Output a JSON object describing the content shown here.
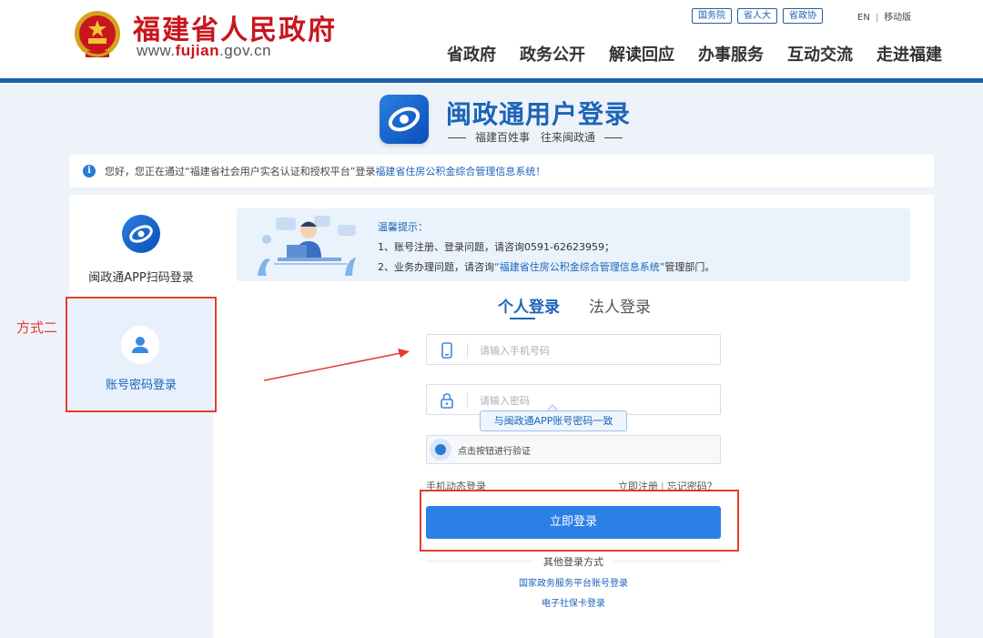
{
  "header": {
    "site_title": "福建省人民政府",
    "site_url_prefix": "www.",
    "site_url_highlight": "fujian",
    "site_url_suffix": ".gov.cn",
    "top_links": [
      "国务院",
      "省人大",
      "省政协"
    ],
    "lang_en": "EN",
    "lang_sep": "|",
    "mobile": "移动版",
    "nav": [
      "省政府",
      "政务公开",
      "解读回应",
      "办事服务",
      "互动交流",
      "走进福建"
    ]
  },
  "banner": {
    "title": "闽政通用户登录",
    "subtitle": "福建百姓事　往来闽政通"
  },
  "notice": {
    "icon_text": "i",
    "text": "您好，您正在通过“福建省社会用户实名认证和授权平台”登录",
    "system_name": "福建省住房公积金综合管理信息系统！"
  },
  "login_methods": [
    {
      "label": "闽政通APP扫码登录",
      "icon": "app-logo-icon"
    },
    {
      "label": "账号密码登录",
      "icon": "user-icon"
    }
  ],
  "annotation": {
    "label": "方式二",
    "color": "#e53b2f"
  },
  "tips": {
    "title": "温馨提示：",
    "line1": "1、账号注册、登录问题，请咨询0591-62623959；",
    "line2_prefix": "2、业务办理问题，请咨询",
    "line2_link": "“福建省住房公积金综合管理信息系统”",
    "line2_suffix": "管理部门。"
  },
  "tabs": {
    "personal": "个人登录",
    "corporate": "法人登录"
  },
  "form": {
    "phone_placeholder": "请输入手机号码",
    "password_placeholder": "请输入密码",
    "tooltip": "与闽政通APP账号密码一致",
    "verify_text": "点击按钮进行验证",
    "sms_login": "手机动态登录",
    "register": "立即注册",
    "link_sep": "|",
    "forgot": "忘记密码？",
    "login_button": "立即登录",
    "other_methods": "其他登录方式",
    "other_links": [
      "国家政务服务平台账号登录",
      "电子社保卡登录"
    ]
  },
  "colors": {
    "accent": "#2a80e6",
    "brand_blue": "#1c64b8",
    "header_red": "#c8161d"
  }
}
